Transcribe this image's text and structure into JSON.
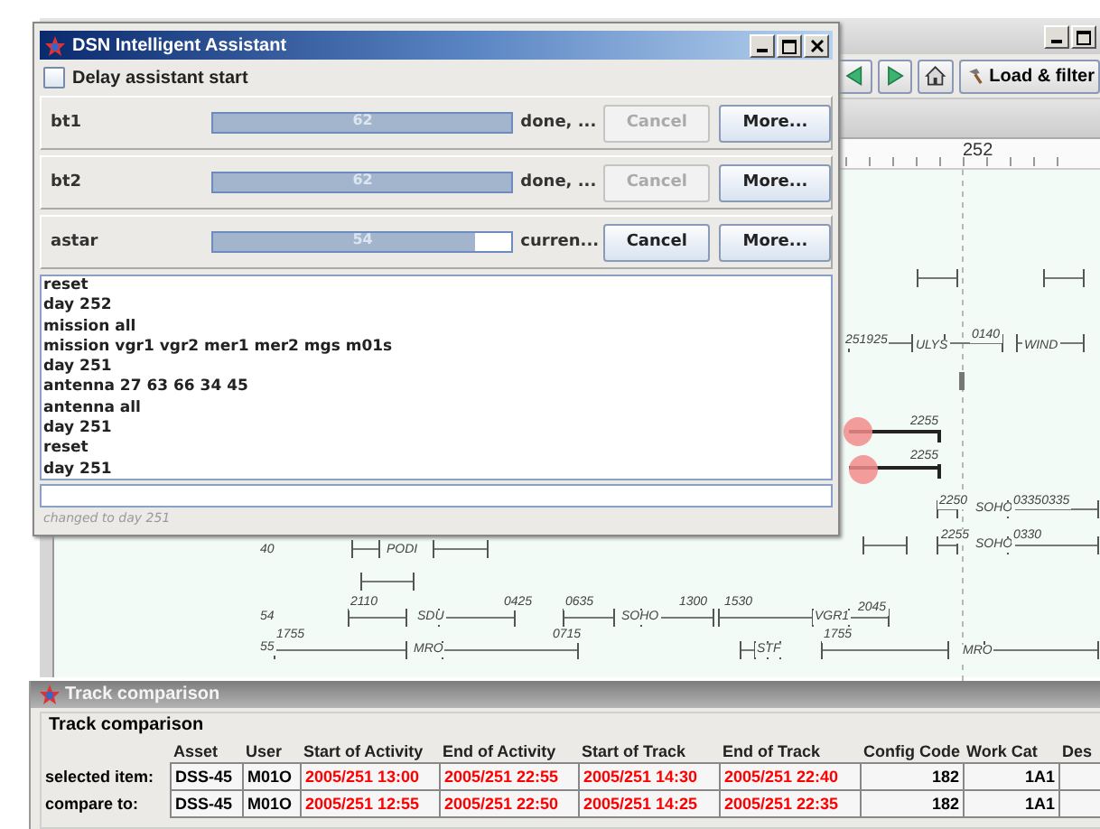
{
  "app": {
    "toolbar": {
      "load_button": "Load & filter"
    },
    "ruler_label": "252",
    "timeline_labels": [
      "251925",
      "ULYS",
      "0140",
      "WIND",
      "2255",
      "2255",
      "2250",
      "SOHO",
      "03350335",
      "2255",
      "SOHO",
      "0330",
      "40",
      "PODI",
      "54",
      "2110",
      "SDU",
      "0425",
      "0635",
      "SOHO",
      "1300",
      "1530",
      "VGR1",
      "2045",
      "55",
      "1755",
      "MRO",
      "0715",
      "STF",
      "1755",
      "MRO"
    ]
  },
  "assistant_dialog": {
    "title": "DSN Intelligent Assistant",
    "delay_checkbox": {
      "label": "Delay assistant start",
      "checked": false
    },
    "tasks": [
      {
        "name": "bt1",
        "level": 1,
        "reading": "62",
        "status": "done, ...",
        "cancel": {
          "label": "Cancel",
          "disabled": true
        },
        "more": "More..."
      },
      {
        "name": "bt2",
        "level": 1,
        "reading": "62",
        "status": "done, ...",
        "cancel": {
          "label": "Cancel",
          "disabled": true
        },
        "more": "More..."
      },
      {
        "name": "astar",
        "level": 0.88,
        "reading": "54",
        "status": "curren...",
        "cancel": {
          "label": "Cancel",
          "disabled": false
        },
        "more": "More..."
      }
    ],
    "log": [
      "reset",
      "day 252",
      "mission all",
      "mission vgr1 vgr2 mer1 mer2 mgs m01s",
      "day 251",
      "antenna 27 63 66 34 45",
      "antenna all",
      "day 251",
      "reset",
      "day 251"
    ],
    "status": "changed to day 251"
  },
  "track_comparison": {
    "title": "Track comparison",
    "group_title": "Track comparison",
    "columns": [
      "Asset",
      "User",
      "Start of Activity",
      "End of Activity",
      "Start of Track",
      "End of Track",
      "Config Code",
      "Work Cat",
      "Des"
    ],
    "rows": [
      {
        "label": "selected item:",
        "cells": [
          {
            "text": "DSS-45",
            "differs": false
          },
          {
            "text": "M01O",
            "differs": false
          },
          {
            "text": "2005/251 13:00",
            "differs": true
          },
          {
            "text": "2005/251 22:55",
            "differs": true
          },
          {
            "text": "2005/251 14:30",
            "differs": true
          },
          {
            "text": "2005/251 22:40",
            "differs": true
          },
          {
            "text": "182",
            "differs": false
          },
          {
            "text": "1A1",
            "differs": false
          }
        ]
      },
      {
        "label": "compare to:",
        "cells": [
          {
            "text": "DSS-45",
            "differs": false
          },
          {
            "text": "M01O",
            "differs": false
          },
          {
            "text": "2005/251 12:55",
            "differs": true
          },
          {
            "text": "2005/251 22:50",
            "differs": true
          },
          {
            "text": "2005/251 14:25",
            "differs": true
          },
          {
            "text": "2005/251 22:35",
            "differs": true
          },
          {
            "text": "182",
            "differs": false
          },
          {
            "text": "1A1",
            "differs": false
          }
        ]
      }
    ]
  }
}
